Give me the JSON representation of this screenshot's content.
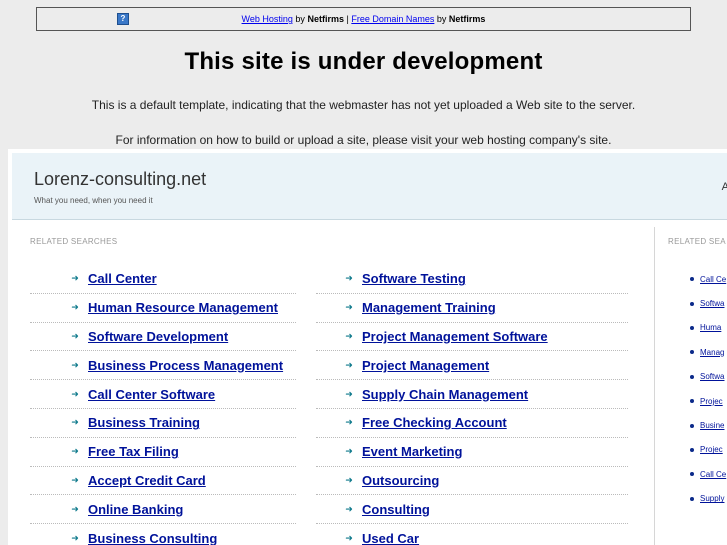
{
  "topbar": {
    "link1": "Web Hosting",
    "by1": "by",
    "brand1": "Netfirms",
    "sep": "|",
    "link2": "Free Domain Names",
    "by2": "by",
    "brand2": "Netfirms",
    "icon": "question-icon"
  },
  "main": {
    "title": "This site is under development",
    "para1": "This is a default template, indicating that the webmaster has not yet uploaded a Web site to the server.",
    "para2": "For information on how to build or upload a site, please visit your web hosting company's site."
  },
  "parked": {
    "site_title": "Lorenz-consulting.net",
    "site_sub": "What you need, when you need it",
    "header_right": "A",
    "related_label": "RELATED SEARCHES",
    "related_label_right": "RELATED SEA",
    "col1": [
      "Call Center",
      "Human Resource Management",
      "Software Development",
      "Business Process Management",
      "Call Center Software",
      "Business Training",
      "Free Tax Filing",
      "Accept Credit Card",
      "Online Banking",
      "Business Consulting"
    ],
    "col2": [
      "Software Testing",
      "Management Training",
      "Project Management Software",
      "Project Management",
      "Supply Chain Management",
      "Free Checking Account",
      "Event Marketing",
      "Outsourcing",
      "Consulting",
      "Used Car"
    ],
    "right": [
      "Call Ce",
      "Softwa",
      "Huma",
      "Manag",
      "Softwa",
      "Projec",
      "Busine",
      "Projec",
      "Call Ce",
      "Supply"
    ],
    "arrow_glyph": "➜"
  }
}
